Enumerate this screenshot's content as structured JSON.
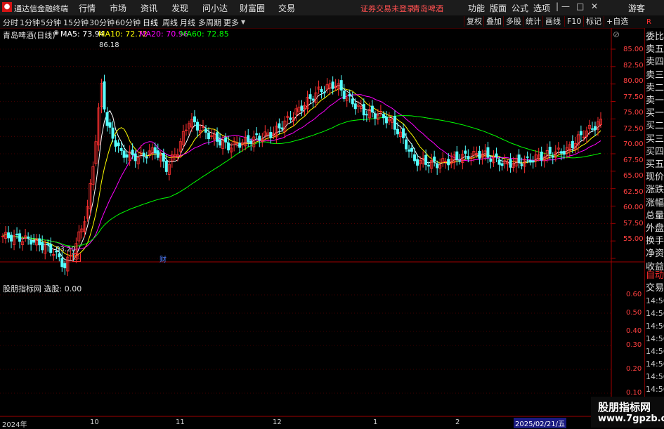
{
  "app": {
    "logo_text": "L",
    "title": "通达信金融终端",
    "menu": [
      "行情",
      "市场",
      "资讯",
      "发现",
      "问小达",
      "财富圈",
      "交易"
    ],
    "login_notice": "证券交易未登录",
    "stock_title": "青岛啤酒",
    "right_menu": [
      "功能",
      "版面",
      "公式",
      "选项"
    ],
    "guest": "游客"
  },
  "toolbar": {
    "periods": [
      "分时",
      "1分钟",
      "5分钟",
      "15分钟",
      "30分钟",
      "60分钟",
      "日线",
      "周线",
      "月线",
      "多周期",
      "更多"
    ],
    "active_period": "日线",
    "buttons": [
      "复权",
      "叠加",
      "多股",
      "统计",
      "画线",
      "F10",
      "标记",
      "+自选"
    ]
  },
  "main_chart": {
    "stock_label": "青岛啤酒(日线)",
    "ma": [
      {
        "label": "MA5: 73.94",
        "color": "#ffffff"
      },
      {
        "label": "MA10: 72.72",
        "color": "#ffff00"
      },
      {
        "label": "MA20: 70.96",
        "color": "#ff00ff"
      },
      {
        "label": "MA60: 72.85",
        "color": "#00ff00"
      }
    ],
    "high_label": "86.18",
    "low_label": "53.20",
    "marker_zhang": "涨",
    "marker_cai": "财",
    "y_ticks": [
      "85.00",
      "82.50",
      "80.00",
      "77.50",
      "75.00",
      "72.50",
      "70.00",
      "67.50",
      "65.00",
      "62.50",
      "60.00",
      "57.50",
      "55.00"
    ]
  },
  "indicator": {
    "label": "股朋指标网 选股: 0.00",
    "y_ticks": [
      "0.60",
      "0.50",
      "0.40",
      "0.30",
      "0.20",
      "0.10"
    ]
  },
  "right_panel": {
    "corner": "R",
    "items": [
      "委比",
      "卖五",
      "卖四",
      "卖三",
      "卖二",
      "卖一",
      "买一",
      "买二",
      "买三",
      "买四",
      "买五",
      "现价",
      "涨跌",
      "涨幅",
      "总量",
      "外盘",
      "换手",
      "净资",
      "收益"
    ],
    "tabs": [
      "自动",
      "交易"
    ],
    "times": [
      "14:56",
      "14:56",
      "14:56",
      "14:56",
      "14:56",
      "14:56",
      "14:56",
      "14:56",
      "14:56"
    ]
  },
  "date_axis": {
    "labels": [
      "2024年",
      "10",
      "11",
      "12",
      "1",
      "2"
    ],
    "cursor_date": "2025/02/21/五"
  },
  "watermark": {
    "title": "股朋指标网",
    "url": "www.7gpzb.com"
  },
  "colors": {
    "up": "#ff3030",
    "down": "#54ffff",
    "ma5": "#ffffff",
    "ma10": "#ffff00",
    "ma20": "#ff00ff",
    "ma60": "#00ff00",
    "grid": "#800000"
  }
}
